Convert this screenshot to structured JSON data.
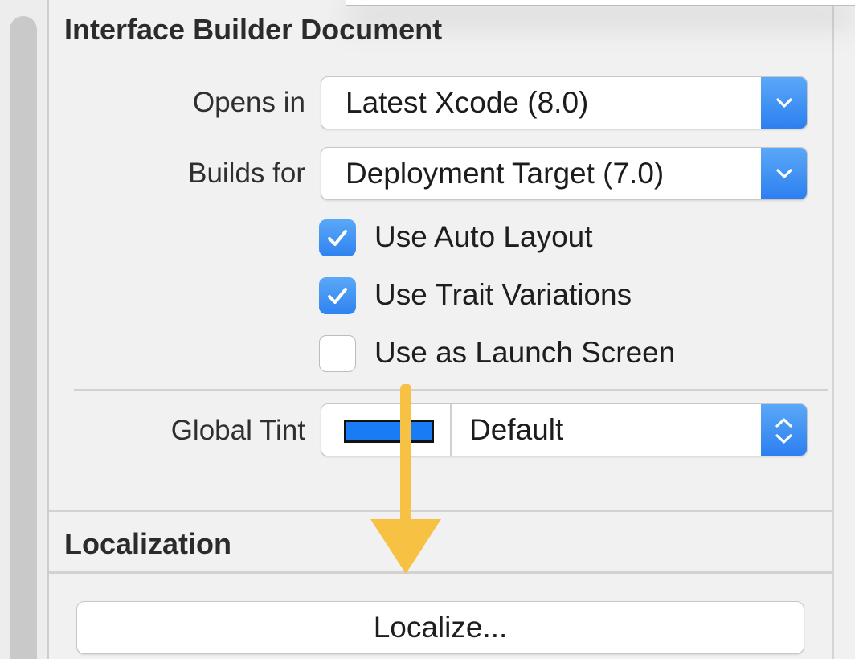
{
  "document_section": {
    "title": "Interface Builder Document",
    "opens_in": {
      "label": "Opens in",
      "value": "Latest Xcode (8.0)"
    },
    "builds_for": {
      "label": "Builds for",
      "value": "Deployment Target (7.0)"
    },
    "checkboxes": [
      {
        "label": "Use Auto Layout",
        "checked": true
      },
      {
        "label": "Use Trait Variations",
        "checked": true
      },
      {
        "label": "Use as Launch Screen",
        "checked": false
      }
    ],
    "global_tint": {
      "label": "Global Tint",
      "value": "Default",
      "swatch_color": "#1a7cf5"
    }
  },
  "localization_section": {
    "title": "Localization",
    "button_label": "Localize..."
  },
  "annotation": {
    "arrow_color": "#f7c244"
  },
  "colors": {
    "accent": "#2f83f0",
    "panel": "#f1f1f1"
  }
}
